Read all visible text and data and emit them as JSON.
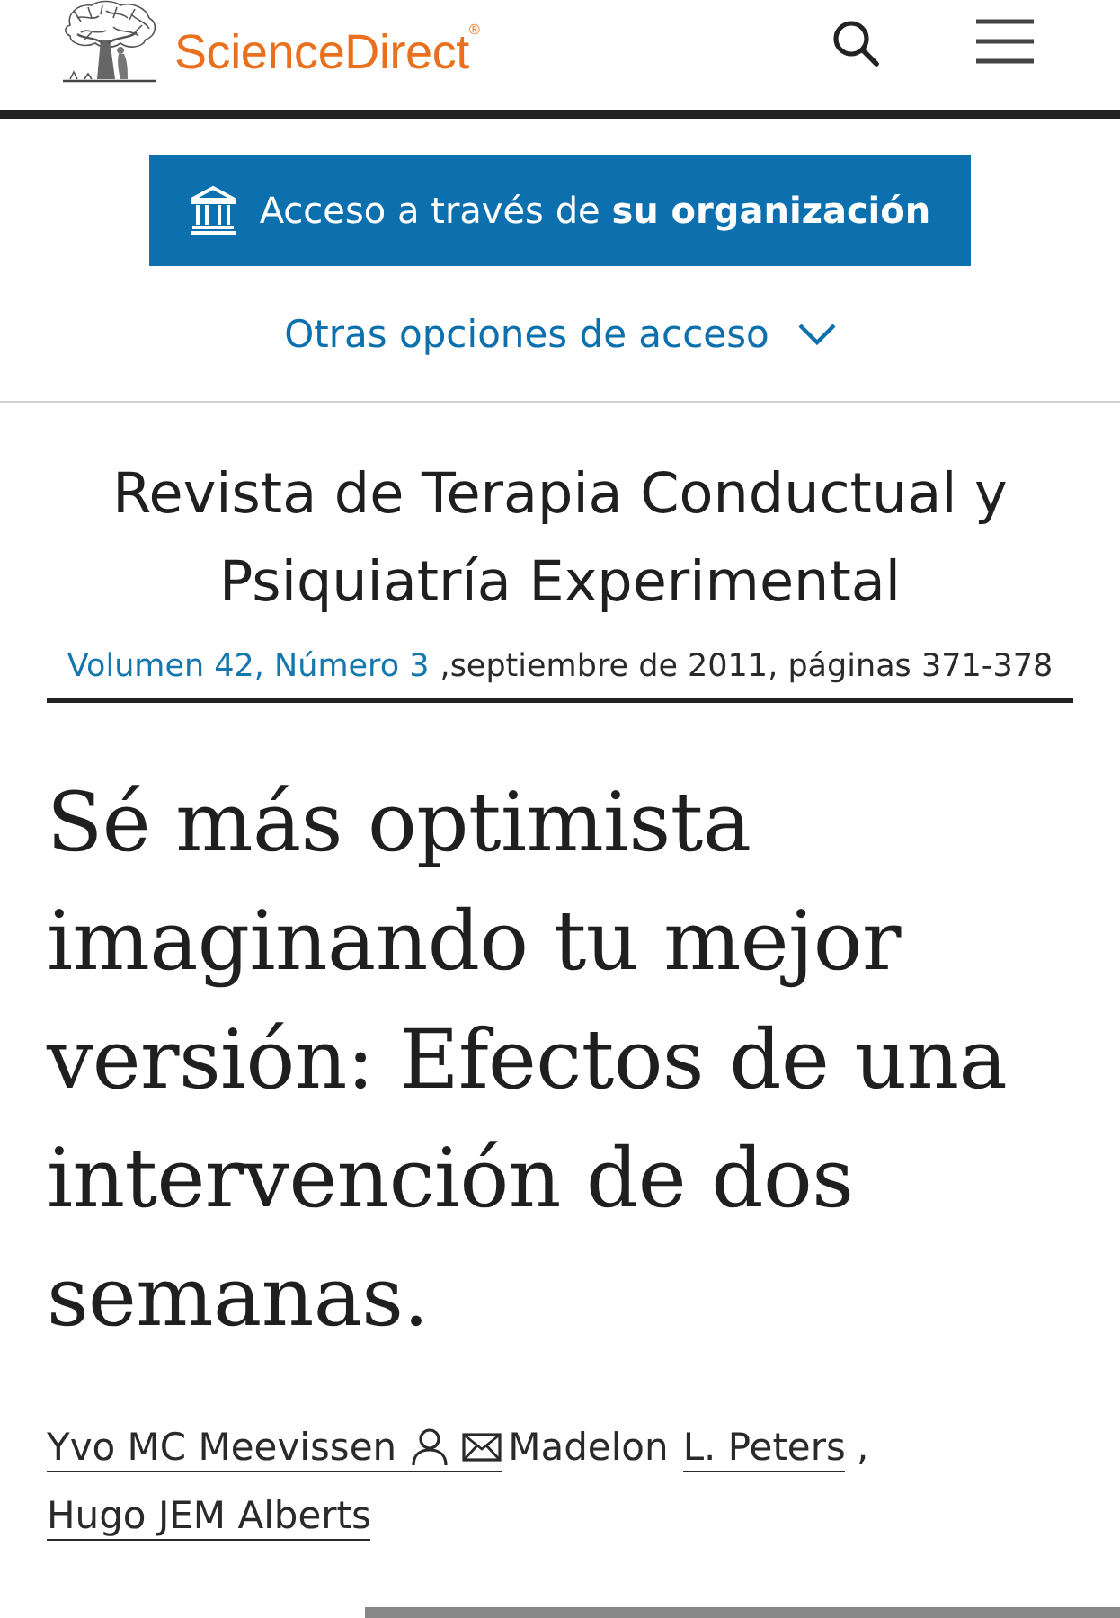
{
  "header": {
    "logo": "ScienceDirect$^{®}$"
  },
  "access": {
    "button": "Acceso a través de **su organización**",
    "options_link": "Otras opciones de acceso",
    "options_expanded": false
  },
  "journal": {
    "title": "Revista de Terapia Conductual y Psiquiatría Experimental",
    "issue": "Volumen 42, Número 3",
    "details": ",septiembre de 2011, páginas 371-378"
  },
  "article": {
    "title": "Sé más optimista imaginando tu mejor versión: Efectos de una intervención de dos semanas."
  },
  "authors": [
    {
      "linked_part": "Yvo MC Meevissen",
      "contact_icons": true
    },
    {
      "unlinked_part": "Madelon",
      "linked_part": "L. Peters",
      "separator": ",",
      "contact_icons": false
    },
    {
      "linked_part": "Hugo JEM Alberts",
      "contact_icons": false
    }
  ]
}
